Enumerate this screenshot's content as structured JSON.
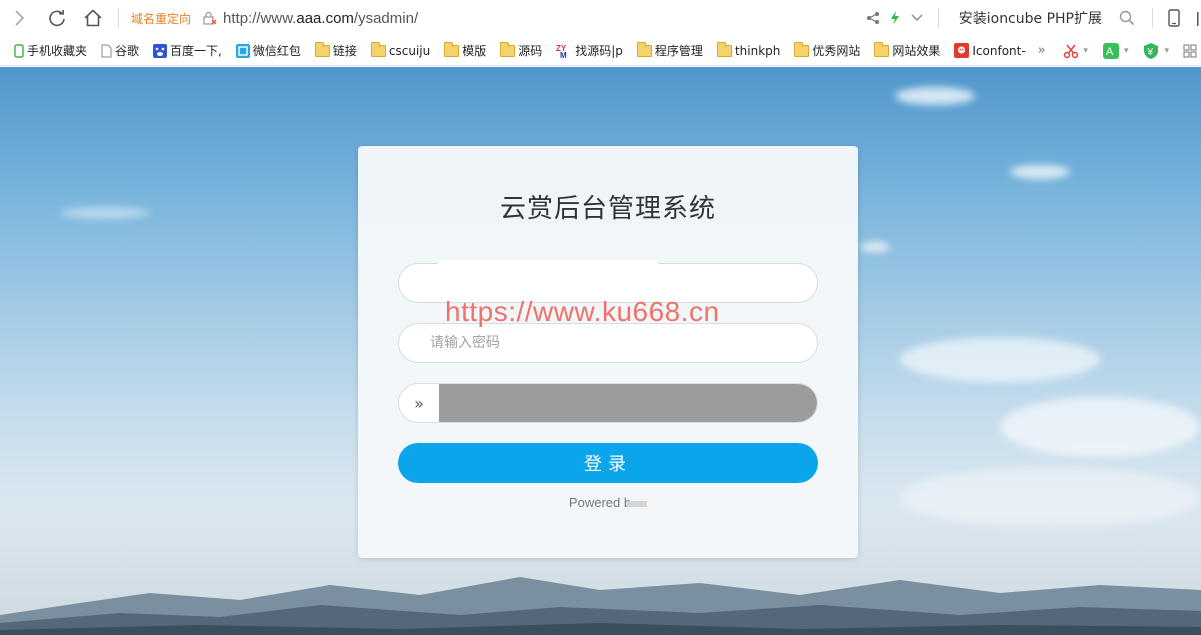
{
  "addressbar": {
    "redirect_label": "域名重定向",
    "url_prefix": "http://www.",
    "url_host": "aaa.com",
    "url_path": "/ysadmin/",
    "search_text": "安装ioncube PHP扩展"
  },
  "bookmarks": [
    {
      "label": "手机收藏夹",
      "icon": "phone-icon"
    },
    {
      "label": "谷歌",
      "icon": "page-icon"
    },
    {
      "label": "百度一下,",
      "icon": "baidu-icon"
    },
    {
      "label": "微信红包",
      "icon": "wechat-icon"
    },
    {
      "label": "链接",
      "icon": "folder-icon"
    },
    {
      "label": "cscuiju",
      "icon": "folder-icon"
    },
    {
      "label": "模版",
      "icon": "folder-icon"
    },
    {
      "label": "源码",
      "icon": "folder-icon"
    },
    {
      "label": "找源码|p",
      "icon": "zym-icon"
    },
    {
      "label": "程序管理",
      "icon": "folder-icon"
    },
    {
      "label": "thinkph",
      "icon": "folder-icon"
    },
    {
      "label": "优秀网站",
      "icon": "folder-icon"
    },
    {
      "label": "网站效果",
      "icon": "folder-icon"
    },
    {
      "label": "Iconfont-",
      "icon": "iconfont-icon"
    }
  ],
  "bookmarks_more": "»",
  "login": {
    "title": "云赏后台管理系统",
    "password_placeholder": "请输入密码",
    "slider_icon": "»",
    "login_label": "登录",
    "powered_text": "Powered b"
  },
  "watermark": "https://www.ku668.cn",
  "colors": {
    "login_button": "#0aa5ea",
    "redirect_text": "#e8821e",
    "watermark": "#f05a50"
  }
}
